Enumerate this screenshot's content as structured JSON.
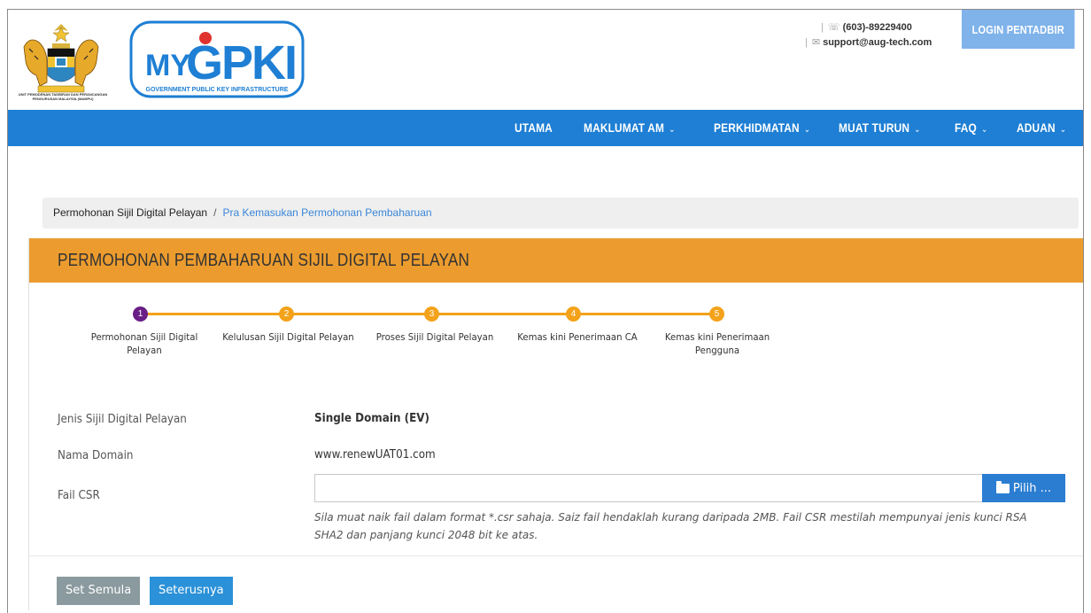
{
  "header": {
    "crest_caption": "UNIT PEMODENAN TADBIRAN DAN PERANCANGAN PENGURUSAN MALAYSIA (MAMPU)",
    "logo_my": "MY",
    "logo_gpki": "GPKI",
    "logo_tagline": "GOVERNMENT PUBLIC KEY INFRASTRUCTURE",
    "phone": "(603)-89229400",
    "email": "support@aug-tech.com",
    "login_label": "LOGIN PENTADBIR"
  },
  "nav": {
    "items": [
      {
        "label": "UTAMA",
        "dropdown": false
      },
      {
        "label": "MAKLUMAT AM",
        "dropdown": true
      },
      {
        "label": "PERKHIDMATAN",
        "dropdown": true
      },
      {
        "label": "MUAT TURUN",
        "dropdown": true
      },
      {
        "label": "FAQ",
        "dropdown": true
      },
      {
        "label": "ADUAN",
        "dropdown": true
      }
    ],
    "chevron": "⌄"
  },
  "breadcrumb": {
    "parent": "Permohonan Sijil Digital Pelayan",
    "separator": "/",
    "current": "Pra Kemasukan Permohonan Pembaharuan"
  },
  "panel": {
    "title": "PERMOHONAN PEMBAHARUAN SIJIL DIGITAL PELAYAN"
  },
  "steps": [
    {
      "number": "1",
      "label_line1": "Permohonan Sijil Digital",
      "label_line2": "Pelayan",
      "active": true
    },
    {
      "number": "2",
      "label_line1": "Kelulusan Sijil Digital Pelayan",
      "label_line2": "",
      "active": false
    },
    {
      "number": "3",
      "label_line1": "Proses Sijil Digital Pelayan",
      "label_line2": "",
      "active": false
    },
    {
      "number": "4",
      "label_line1": "Kemas kini Penerimaan CA",
      "label_line2": "",
      "active": false
    },
    {
      "number": "5",
      "label_line1": "Kemas kini Penerimaan",
      "label_line2": "Pengguna",
      "active": false
    }
  ],
  "form": {
    "type_label": "Jenis Sijil Digital Pelayan",
    "type_value": "Single Domain (EV)",
    "domain_label": "Nama Domain",
    "domain_value": "www.renewUAT01.com",
    "csr_label": "Fail CSR",
    "csr_value": "",
    "pick_label": "Pilih ...",
    "help_line1": "Sila muat naik fail dalam format *.csr sahaja. Saiz fail hendaklah kurang daripada 2MB. Fail CSR mestilah mempunyai jenis kunci RSA",
    "help_line2": "SHA2 dan panjang kunci 2048 bit ke atas."
  },
  "buttons": {
    "reset": "Set Semula",
    "next": "Seterusnya"
  },
  "colors": {
    "nav": "#1e7fd4",
    "panel_header": "#ec9c2e",
    "step": "#f3a21a",
    "step_active": "#6a1f86",
    "login": "#7fb3ea"
  }
}
